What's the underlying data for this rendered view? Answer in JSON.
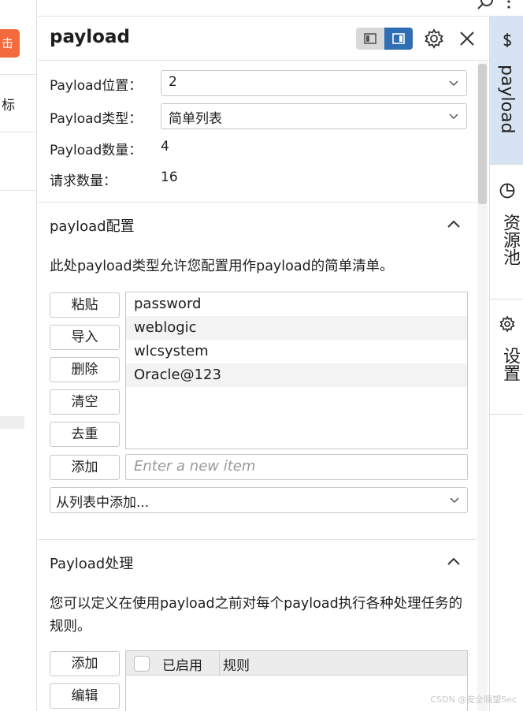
{
  "left_app": {
    "orange_button_glyph": "击",
    "partial_text": "标"
  },
  "panel": {
    "title": "payload",
    "fields": [
      {
        "label": "Payload位置：",
        "value": "2",
        "kind": "select"
      },
      {
        "label": "Payload类型：",
        "value": "简单列表",
        "kind": "select"
      },
      {
        "label": "Payload数量：",
        "value": "4",
        "kind": "static"
      },
      {
        "label": "请求数量：",
        "value": "16",
        "kind": "static"
      }
    ],
    "config": {
      "title": "payload配置",
      "description": "此处payload类型允许您配置用作payload的简单清单。",
      "buttons": {
        "paste": "粘贴",
        "import": "导入",
        "delete": "删除",
        "clear": "清空",
        "dedup": "去重",
        "add": "添加"
      },
      "items": [
        "password",
        "weblogic",
        "wlcsystem",
        "Oracle@123"
      ],
      "new_item_placeholder": "Enter a new item",
      "add_from_list": "从列表中添加..."
    },
    "processing": {
      "title": "Payload处理",
      "description": "您可以定义在使用payload之前对每个payload执行各种处理任务的规则。",
      "buttons": {
        "add": "添加",
        "edit": "编辑"
      },
      "columns": {
        "enabled": "已启用",
        "rule": "规则"
      }
    }
  },
  "right_bar": {
    "tabs": [
      {
        "label": "payload",
        "icon": "dollar-icon",
        "active": true
      },
      {
        "label": "资源池",
        "icon": "pie-chart-icon",
        "active": false
      },
      {
        "label": "设置",
        "icon": "gear-icon",
        "active": false
      }
    ]
  },
  "watermark": "CSDN @安全晴望Sec",
  "colors": {
    "accent": "#2f6db4",
    "orange": "#f26a3d",
    "active_tab": "#d6e3f3"
  }
}
